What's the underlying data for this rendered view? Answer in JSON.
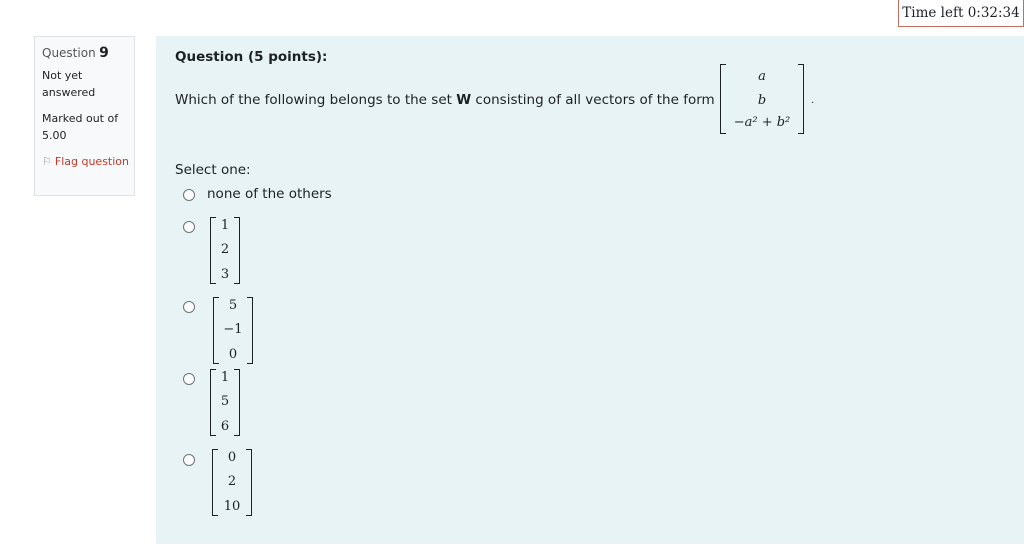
{
  "timer": {
    "text": "Time left 0:32:34"
  },
  "info": {
    "question_label": "Question",
    "question_number": "9",
    "state": "Not yet answered",
    "grade": "Marked out of 5.00",
    "flag_label": "Flag question",
    "flag_icon": "flag-icon"
  },
  "question": {
    "title": "Question (5 points):",
    "text_before": "Which of the following belongs to the set ",
    "set_name": "W",
    "text_after": " consisting of all vectors of the form",
    "form_vector": [
      "a",
      "b",
      "−a² + b²"
    ],
    "period": "."
  },
  "answers": {
    "prompt": "Select one:",
    "options": [
      {
        "type": "text",
        "label": "none of the others"
      },
      {
        "type": "vector",
        "values": [
          "1",
          "2",
          "3"
        ]
      },
      {
        "type": "vector",
        "values": [
          "5",
          "−1",
          "0"
        ]
      },
      {
        "type": "vector",
        "values": [
          "1",
          "5",
          "6"
        ]
      },
      {
        "type": "vector",
        "values": [
          "0",
          "2",
          "10"
        ]
      }
    ]
  },
  "colors": {
    "content_background": "#e7f3f5",
    "info_background": "#f8f9fa",
    "flag_text": "#c0392b",
    "timer_border": "#c26c62"
  }
}
